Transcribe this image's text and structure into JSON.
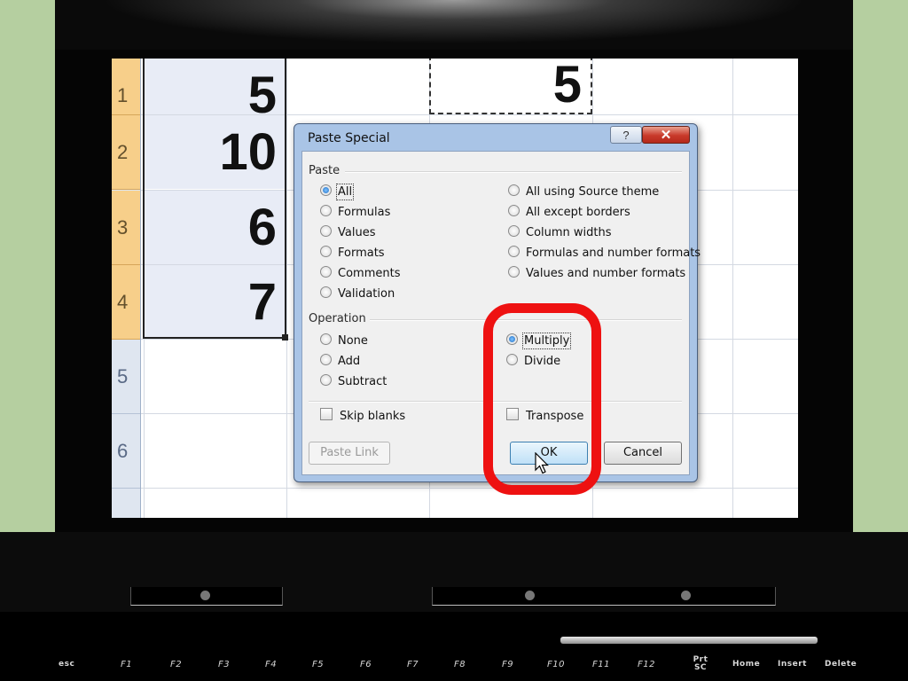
{
  "spreadsheet": {
    "row_headers": [
      {
        "label": "1",
        "selected": true
      },
      {
        "label": "2",
        "selected": true
      },
      {
        "label": "3",
        "selected": true
      },
      {
        "label": "4",
        "selected": true
      },
      {
        "label": "5",
        "selected": false
      },
      {
        "label": "6",
        "selected": false
      }
    ],
    "column_values": [
      "5",
      "10",
      "6",
      "7"
    ],
    "copied_cell_value": "5"
  },
  "dialog": {
    "title": "Paste Special",
    "help_label": "?",
    "close_label": "✕",
    "paste_group_label": "Paste",
    "paste_options_left": [
      {
        "label": "All",
        "selected": true
      },
      {
        "label": "Formulas",
        "selected": false
      },
      {
        "label": "Values",
        "selected": false
      },
      {
        "label": "Formats",
        "selected": false
      },
      {
        "label": "Comments",
        "selected": false
      },
      {
        "label": "Validation",
        "selected": false
      }
    ],
    "paste_options_right": [
      {
        "label": "All using Source theme",
        "selected": false
      },
      {
        "label": "All except borders",
        "selected": false
      },
      {
        "label": "Column widths",
        "selected": false
      },
      {
        "label": "Formulas and number formats",
        "selected": false
      },
      {
        "label": "Values and number formats",
        "selected": false
      }
    ],
    "operation_group_label": "Operation",
    "operation_options_left": [
      {
        "label": "None",
        "selected": false
      },
      {
        "label": "Add",
        "selected": false
      },
      {
        "label": "Subtract",
        "selected": false
      }
    ],
    "operation_options_right": [
      {
        "label": "Multiply",
        "selected": true
      },
      {
        "label": "Divide",
        "selected": false
      }
    ],
    "skip_blanks_label": "Skip blanks",
    "transpose_label": "Transpose",
    "paste_link_label": "Paste Link",
    "ok_label": "OK",
    "cancel_label": "Cancel"
  },
  "keyboard": {
    "keys": [
      "esc",
      "F1",
      "F2",
      "F3",
      "F4",
      "F5",
      "F6",
      "F7",
      "F8",
      "F9",
      "F10",
      "F11",
      "F12",
      "Prt SC",
      "Home",
      "Insert",
      "Delete"
    ]
  },
  "colors": {
    "highlight": "#ee1111",
    "background": "#b5cfa0",
    "dialog_frame": "#a9c4e6"
  }
}
